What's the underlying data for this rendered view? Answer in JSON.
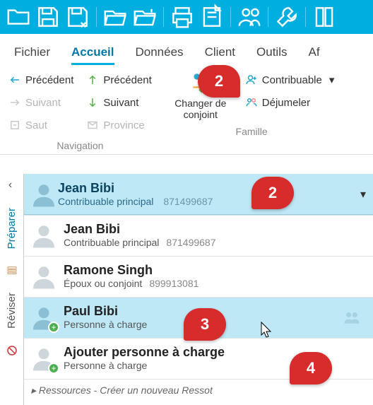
{
  "colors": {
    "primary": "#00aee0",
    "highlight": "#bfe8f6",
    "callout": "#d62c2c",
    "accentGreen": "#4caf50"
  },
  "appbar": {
    "icons": [
      "folder",
      "save",
      "save-as",
      "open",
      "open-recent",
      "print",
      "note",
      "users-swap",
      "wrench",
      "book"
    ]
  },
  "tabs": {
    "items": [
      "Fichier",
      "Accueil",
      "Données",
      "Client",
      "Outils",
      "Af"
    ],
    "activeIndex": 1
  },
  "ribbon": {
    "nav": {
      "prev": "Précédent",
      "next": "Suivant",
      "jump": "Saut",
      "prevUp": "Précédent",
      "nextDown": "Suivant",
      "province": "Province",
      "label": "Navigation"
    },
    "family": {
      "changeSpouse": "Changer de conjoint",
      "taxpayer": "Contribuable",
      "unlink": "Déjumeler",
      "label": "Famille"
    }
  },
  "rail": {
    "prepare": "Préparer",
    "review": "Réviser"
  },
  "taxpayer": {
    "name": "Jean Bibi",
    "role": "Contribuable principal",
    "sin": "871499687"
  },
  "dropdown": [
    {
      "name": "Jean Bibi",
      "role": "Contribuable principal",
      "sin": "871499687",
      "plus": false,
      "active": false
    },
    {
      "name": "Ramone Singh",
      "role": "Époux ou conjoint",
      "sin": "899913081",
      "plus": false,
      "active": false
    },
    {
      "name": "Paul Bibi",
      "role": "Personne à charge",
      "sin": "",
      "plus": true,
      "active": true
    },
    {
      "name": "Ajouter personne à charge",
      "role": "Personne à charge",
      "sin": "",
      "plus": true,
      "active": false
    }
  ],
  "ghost": {
    "label": "Ressources",
    "hint": "Créer un nouveau Ressot"
  },
  "callouts": {
    "a": "2",
    "b": "2",
    "c": "3",
    "d": "4"
  }
}
